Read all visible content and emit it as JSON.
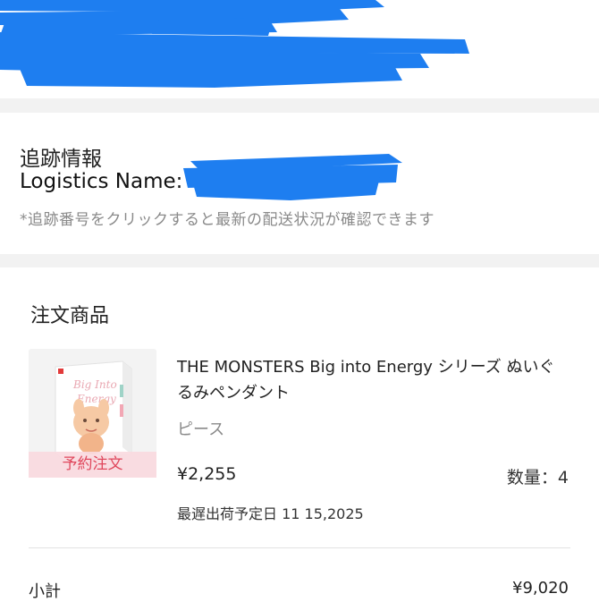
{
  "tracking": {
    "title": "追跡情報",
    "logistics_label": "Logistics Name:",
    "note": "*追跡番号をクリックすると最新の配送状況が確認できます"
  },
  "order": {
    "section_title": "注文商品",
    "item": {
      "badge": "予約注文",
      "name": "THE MONSTERS Big into Energy シリーズ ぬいぐるみペンダント",
      "variant": "ピース",
      "price": "¥2,255",
      "quantity_label": "数量：",
      "quantity": "4",
      "ship_date": "最遅出荷予定日 11 15,2025"
    },
    "subtotal_label": "小計",
    "subtotal_value": "¥9,020"
  },
  "colors": {
    "redaction": "#1e7ef0",
    "badge_bg": "#fadae0",
    "badge_text": "#e0475c",
    "muted_text": "#8a8a8a"
  }
}
